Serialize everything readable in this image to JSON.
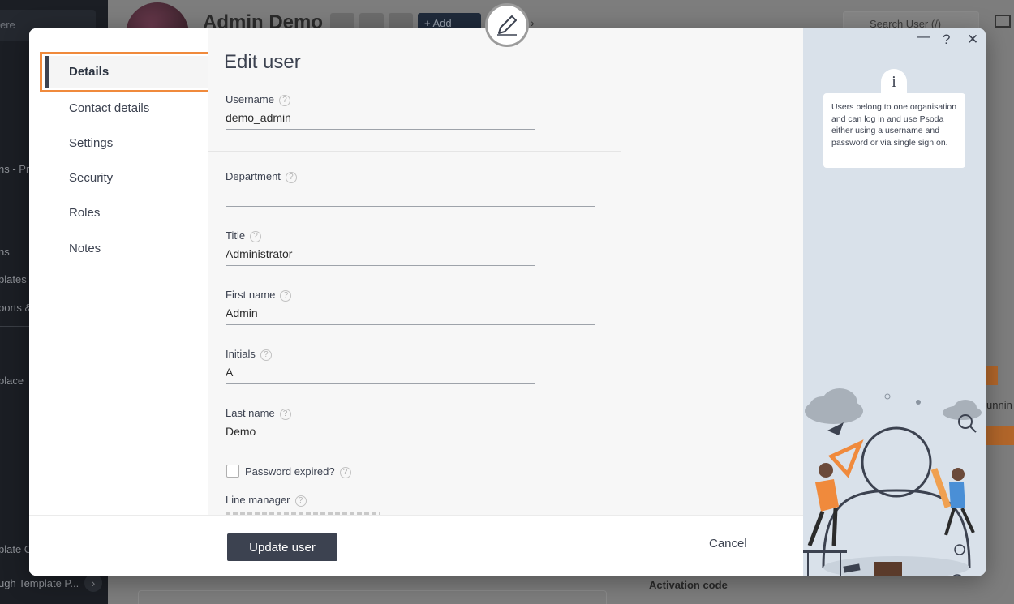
{
  "background": {
    "sidebar": {
      "search_partial": "ere",
      "items": [
        "ns - Pro",
        "ns",
        "plates",
        "ports &",
        "place",
        "plate C",
        "ugh Template P..."
      ],
      "expand_glyph": "›"
    },
    "header": {
      "title": "Admin Demo",
      "add_label": "+ Add",
      "search_placeholder": "Search User (/)",
      "more_glyph": "›"
    },
    "right_text": "unnin",
    "activation_label": "Activation code"
  },
  "modal": {
    "nav": {
      "items": [
        {
          "label": "Details",
          "active": true
        },
        {
          "label": "Contact details"
        },
        {
          "label": "Settings"
        },
        {
          "label": "Security"
        },
        {
          "label": "Roles"
        },
        {
          "label": "Notes"
        }
      ]
    },
    "form": {
      "title": "Edit user",
      "help_glyph": "?",
      "fields": {
        "username": {
          "label": "Username",
          "value": "demo_admin"
        },
        "department": {
          "label": "Department",
          "value": ""
        },
        "title": {
          "label": "Title",
          "value": "Administrator"
        },
        "first_name": {
          "label": "First name",
          "value": "Admin"
        },
        "initials": {
          "label": "Initials",
          "value": "A"
        },
        "last_name": {
          "label": "Last name",
          "value": "Demo"
        },
        "password_expired": {
          "label": "Password expired?",
          "checked": false
        },
        "line_manager": {
          "label": "Line manager"
        }
      }
    },
    "footer": {
      "update_label": "Update user",
      "cancel_label": "Cancel"
    },
    "side_panel": {
      "controls": {
        "minimize": "—",
        "help": "?",
        "close": "✕"
      },
      "info_glyph": "i",
      "info_text": "Users belong to one organisation and can log in and use Psoda either using a username and password or via single sign on."
    },
    "header_icon": "pencil-icon",
    "colors": {
      "primary": "#3c4250",
      "highlight": "#f08a3c",
      "side_panel_bg": "#d9e1ea",
      "illustration_orange": "#f08a3c",
      "illustration_blue": "#4a8fd6"
    }
  }
}
